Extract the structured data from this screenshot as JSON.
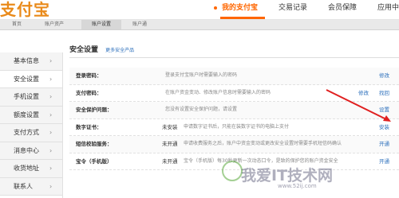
{
  "header": {
    "logo_text": "支付宝",
    "nav": [
      {
        "label": "我的支付宝",
        "active": true
      },
      {
        "label": "交易记录",
        "active": false
      },
      {
        "label": "会员保障",
        "active": false
      },
      {
        "label": "应用中心",
        "active": false
      }
    ]
  },
  "subnav": {
    "tabs": [
      {
        "label": "首页",
        "active": false
      },
      {
        "label": "账户资产",
        "active": false
      },
      {
        "label": "账户设置",
        "active": true
      },
      {
        "label": "账户通",
        "active": false
      }
    ]
  },
  "sidebar": {
    "items": [
      {
        "label": "基本信息",
        "active": false
      },
      {
        "label": "安全设置",
        "active": true
      },
      {
        "label": "手机设置",
        "active": false
      },
      {
        "label": "额度设置",
        "active": false
      },
      {
        "label": "支付方式",
        "active": false
      },
      {
        "label": "消息中心",
        "active": false
      },
      {
        "label": "收货地址",
        "active": false
      },
      {
        "label": "联系人",
        "active": false
      }
    ]
  },
  "main": {
    "title": "安全设置",
    "more_link": "更多安全产品",
    "rows": [
      {
        "label": "登录密码：",
        "status": "",
        "desc": "登录支付宝账户时需要输入的密码",
        "action": "修改",
        "action2": ""
      },
      {
        "label": "支付密码：",
        "status": "",
        "desc": "在账户资金变动、修改账户信息时需要输入的密码",
        "action": "找回",
        "action2": "修改"
      },
      {
        "label": "安全保护问题：",
        "status": "",
        "desc": "您没有设置安全保护问题，请设置",
        "action": "设置",
        "action2": ""
      },
      {
        "label": "数字证书：",
        "status": "未安装",
        "desc": "申请数字证书后，只能在装数字证书的电脑上支付",
        "action": "安装",
        "action2": ""
      },
      {
        "label": "短信校验服务：",
        "status": "未开通",
        "desc": "申请收费服务之后，账户中资金变动或更改安全设置时需要手机短信码确认",
        "action": "开通",
        "action2": ""
      },
      {
        "label": "宝令（手机版）",
        "status": "未开通",
        "desc": "宝令（手机版）每30秒更新一次动态口令，是致的保护您的账户资金安全",
        "action": "开通",
        "action2": ""
      }
    ]
  },
  "watermark": {
    "text": "我爱IT技术网",
    "url": "www.52ij.com"
  },
  "colors": {
    "accent": "#ff6600",
    "link": "#2a6ebb",
    "arrow": "#e02020"
  }
}
